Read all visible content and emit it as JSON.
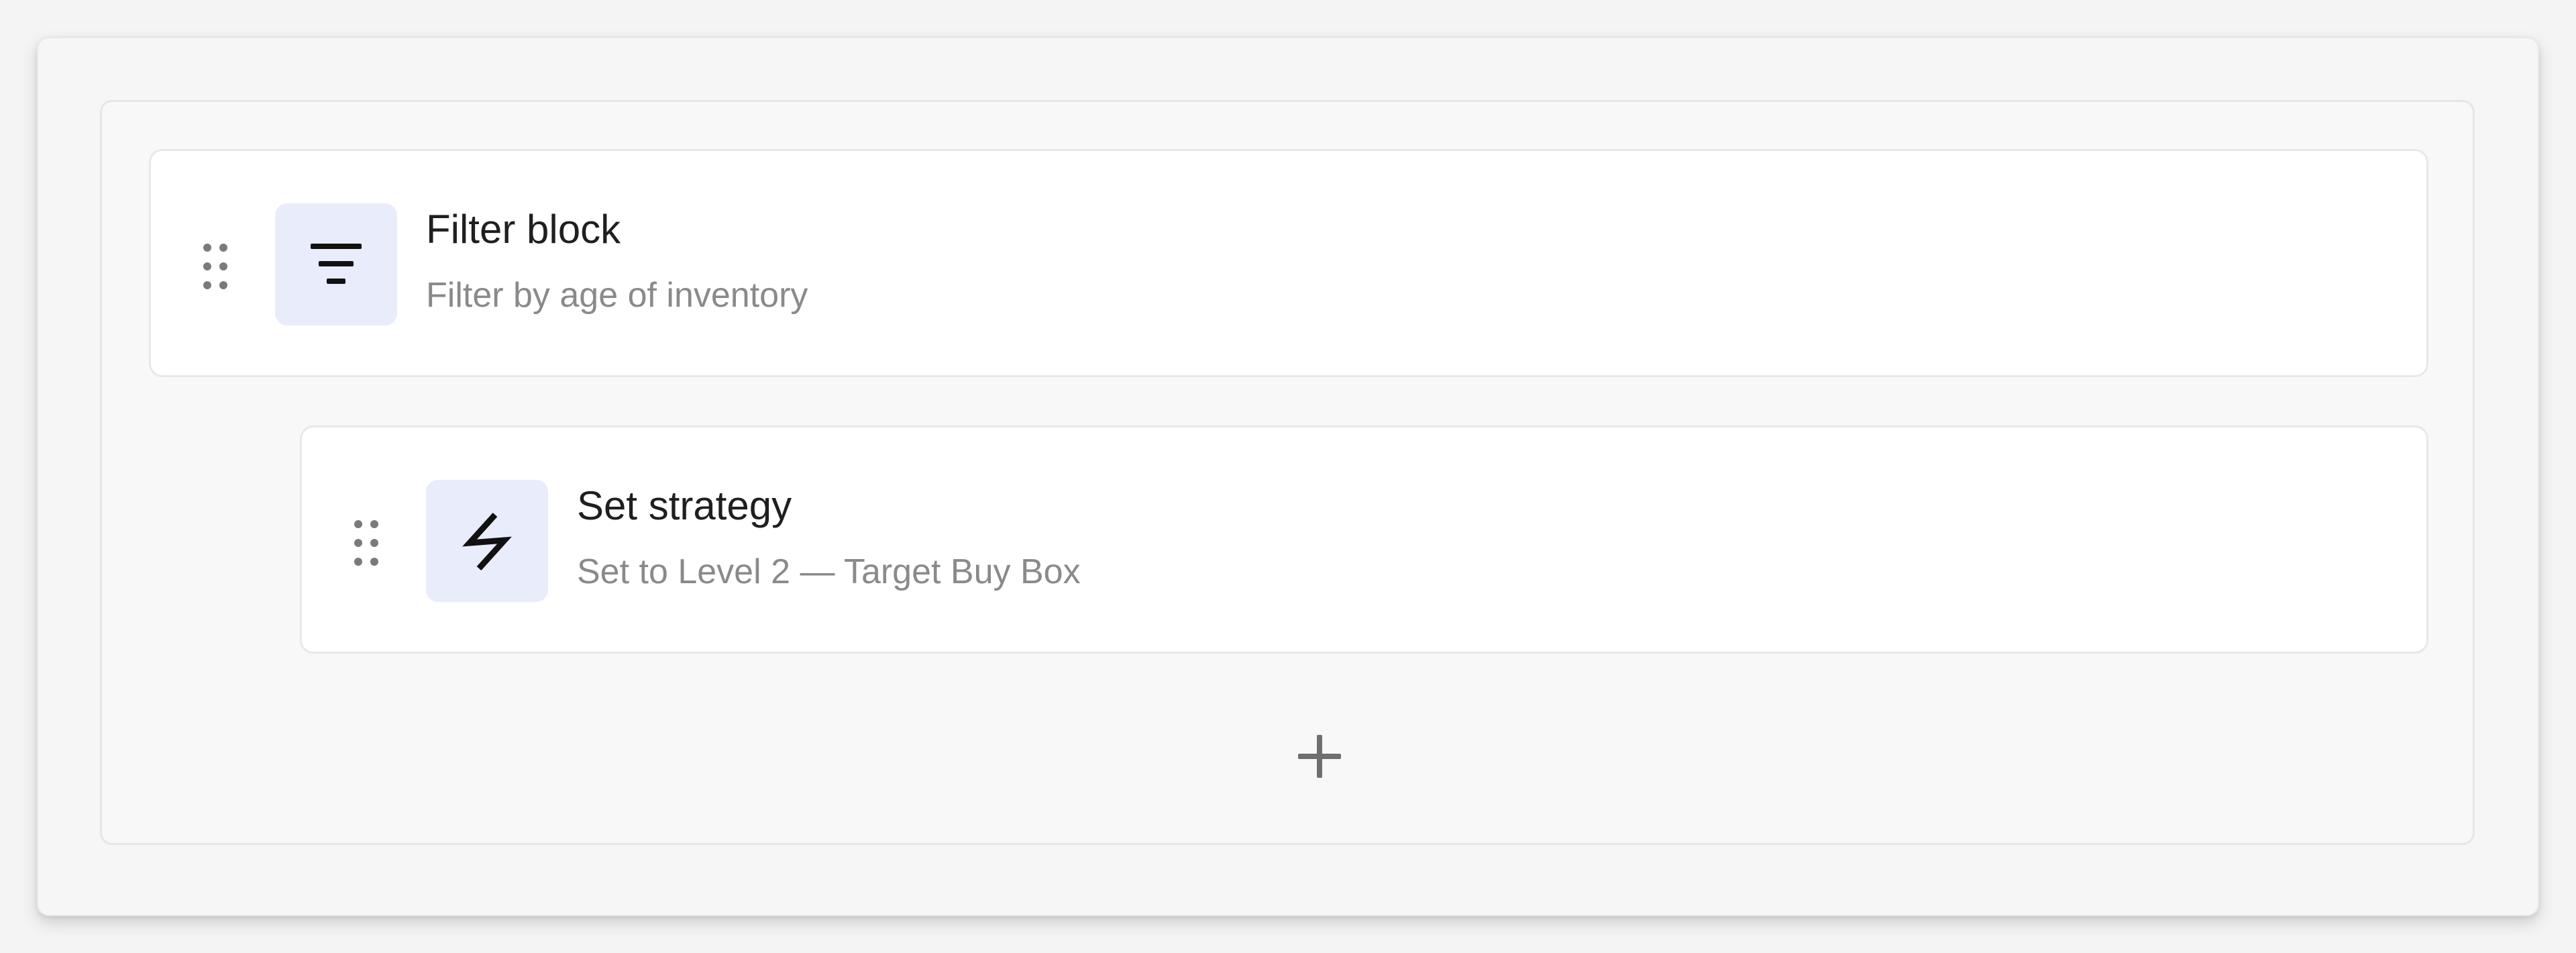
{
  "blocks": [
    {
      "title": "Filter block",
      "subtitle": "Filter by age of inventory",
      "icon": "filter-lines-icon"
    },
    {
      "title": "Set strategy",
      "subtitle": "Set to Level 2 — Target Buy Box",
      "icon": "lightning-bolt-icon"
    }
  ],
  "add_button": {
    "icon": "plus-icon"
  },
  "colors": {
    "icon_tile_bg": "#e9ecfb",
    "card_bg": "#ffffff",
    "title_text": "#1f1f1f",
    "subtitle_text": "#8a8a8a",
    "handle_dots": "#7a7a7a",
    "plus_icon": "#6f6f6f"
  }
}
